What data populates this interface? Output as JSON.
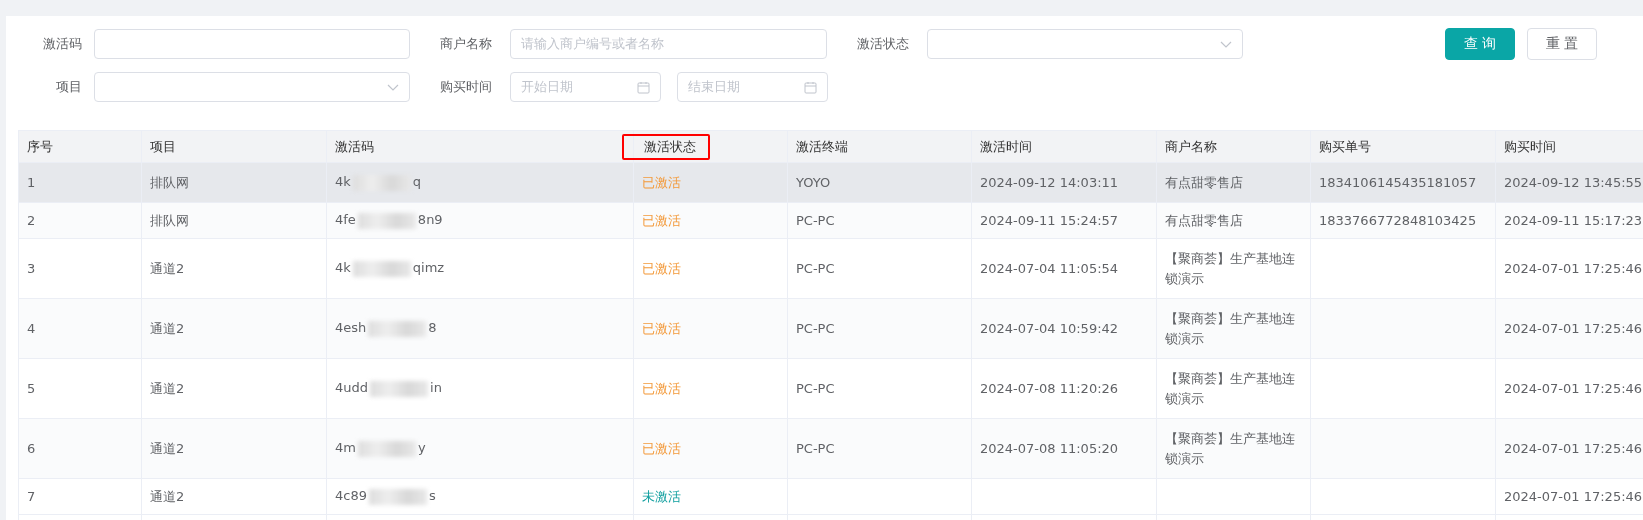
{
  "filters": [
    {
      "label": "激活码",
      "kind": "text"
    },
    {
      "label": "商户名称",
      "kind": "text",
      "placeholder": "请输入商户编号或者名称"
    },
    {
      "label": "激活状态",
      "kind": "select"
    },
    {
      "label": "项目",
      "kind": "select"
    },
    {
      "label": "购买时间",
      "kind": "daterange",
      "start_placeholder": "开始日期",
      "end_placeholder": "结束日期"
    }
  ],
  "buttons": [
    {
      "label": "查询",
      "kind": "primary"
    },
    {
      "label": "重置",
      "kind": "default"
    }
  ],
  "table": {
    "columns": [
      {
        "label": "序号",
        "highlighted": false
      },
      {
        "label": "项目",
        "highlighted": false
      },
      {
        "label": "激活码",
        "highlighted": false
      },
      {
        "label": "激活状态",
        "highlighted": true
      },
      {
        "label": "激活终端",
        "highlighted": false
      },
      {
        "label": "激活时间",
        "highlighted": false
      },
      {
        "label": "商户名称",
        "highlighted": false
      },
      {
        "label": "购买单号",
        "highlighted": false
      },
      {
        "label": "购买时间",
        "highlighted": false
      }
    ],
    "rows": [
      {
        "selected": true,
        "index": "1",
        "project": "排队网",
        "code_start": "4k",
        "code_end": "q",
        "status": "已激活",
        "activated": true,
        "terminal": "YOYO",
        "activation_time": "2024-09-12 14:03:11",
        "merchant": "有点甜零售店",
        "order_no": "1834106145435181057",
        "purchase_time": "2024-09-12 13:45:55"
      },
      {
        "selected": false,
        "index": "2",
        "project": "排队网",
        "code_start": "4fe",
        "code_end": "8n9",
        "status": "已激活",
        "activated": true,
        "terminal": "PC-PC",
        "activation_time": "2024-09-11 15:24:57",
        "merchant": "有点甜零售店",
        "order_no": "1833766772848103425",
        "purchase_time": "2024-09-11 15:17:23"
      },
      {
        "selected": false,
        "index": "3",
        "project": "通道2",
        "code_start": "4k",
        "code_end": "qimz",
        "status": "已激活",
        "activated": true,
        "terminal": "PC-PC",
        "activation_time": "2024-07-04 11:05:54",
        "merchant": "【聚商荟】生产基地连锁演示",
        "order_no": "",
        "purchase_time": "2024-07-01 17:25:46"
      },
      {
        "selected": false,
        "index": "4",
        "project": "通道2",
        "code_start": "4esh",
        "code_end": "8",
        "status": "已激活",
        "activated": true,
        "terminal": "PC-PC",
        "activation_time": "2024-07-04 10:59:42",
        "merchant": "【聚商荟】生产基地连锁演示",
        "order_no": "",
        "purchase_time": "2024-07-01 17:25:46"
      },
      {
        "selected": false,
        "index": "5",
        "project": "通道2",
        "code_start": "4udd",
        "code_end": "in",
        "status": "已激活",
        "activated": true,
        "terminal": "PC-PC",
        "activation_time": "2024-07-08 11:20:26",
        "merchant": "【聚商荟】生产基地连锁演示",
        "order_no": "",
        "purchase_time": "2024-07-01 17:25:46"
      },
      {
        "selected": false,
        "index": "6",
        "project": "通道2",
        "code_start": "4m",
        "code_end": "y",
        "status": "已激活",
        "activated": true,
        "terminal": "PC-PC",
        "activation_time": "2024-07-08 11:05:20",
        "merchant": "【聚商荟】生产基地连锁演示",
        "order_no": "",
        "purchase_time": "2024-07-01 17:25:46"
      },
      {
        "selected": false,
        "index": "7",
        "project": "通道2",
        "code_start": "4c89",
        "code_end": "s",
        "status": "未激活",
        "activated": false,
        "terminal": "",
        "activation_time": "",
        "merchant": "",
        "order_no": "",
        "purchase_time": "2024-07-01 17:25:46"
      }
    ]
  }
}
